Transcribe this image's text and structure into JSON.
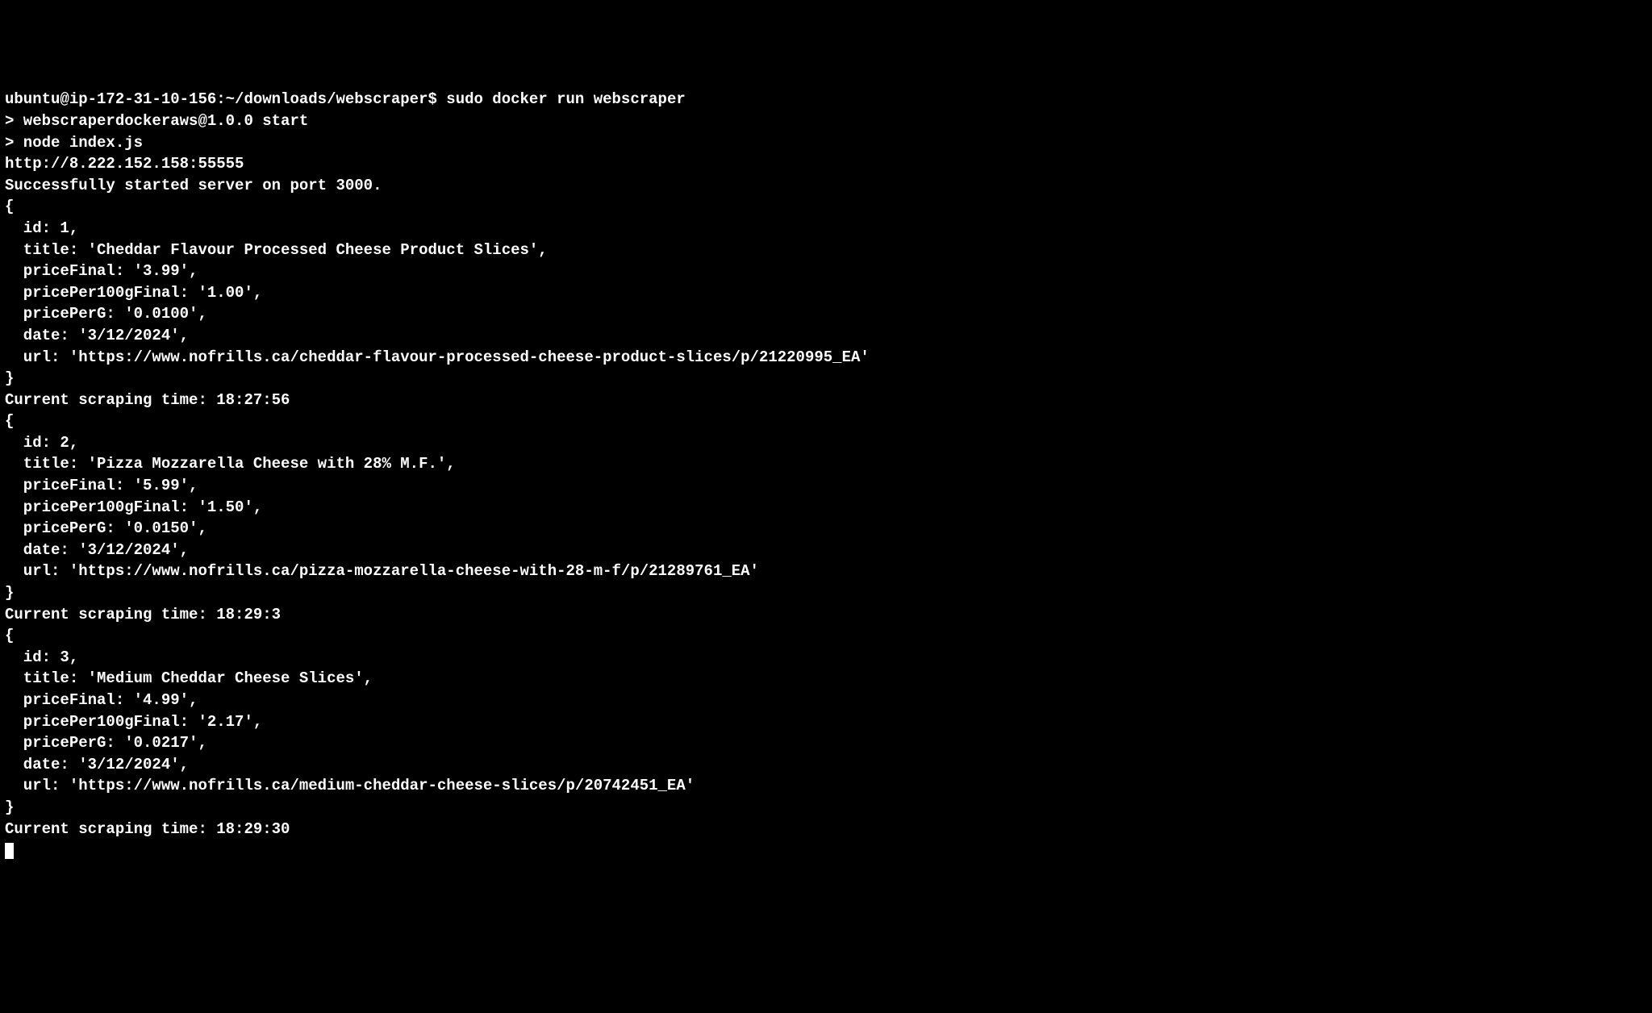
{
  "terminal": {
    "prompt": "ubuntu@ip-172-31-10-156:~/downloads/webscraper$ ",
    "command": "sudo docker run webscraper",
    "blank1": "",
    "line1": "> webscraperdockeraws@1.0.0 start",
    "line2": "> node index.js",
    "blank2": "",
    "line3": "http://8.222.152.158:55555",
    "line4": "Successfully started server on port 3000.",
    "obj1_open": "{",
    "obj1_id": "  id: 1,",
    "obj1_title": "  title: 'Cheddar Flavour Processed Cheese Product Slices',",
    "obj1_priceFinal": "  priceFinal: '3.99',",
    "obj1_pricePer100g": "  pricePer100gFinal: '1.00',",
    "obj1_pricePerG": "  pricePerG: '0.0100',",
    "obj1_date": "  date: '3/12/2024',",
    "obj1_url": "  url: 'https://www.nofrills.ca/cheddar-flavour-processed-cheese-product-slices/p/21220995_EA'",
    "obj1_close": "}",
    "time1": "Current scraping time: 18:27:56",
    "obj2_open": "{",
    "obj2_id": "  id: 2,",
    "obj2_title": "  title: 'Pizza Mozzarella Cheese with 28% M.F.',",
    "obj2_priceFinal": "  priceFinal: '5.99',",
    "obj2_pricePer100g": "  pricePer100gFinal: '1.50',",
    "obj2_pricePerG": "  pricePerG: '0.0150',",
    "obj2_date": "  date: '3/12/2024',",
    "obj2_url": "  url: 'https://www.nofrills.ca/pizza-mozzarella-cheese-with-28-m-f/p/21289761_EA'",
    "obj2_close": "}",
    "time2": "Current scraping time: 18:29:3",
    "obj3_open": "{",
    "obj3_id": "  id: 3,",
    "obj3_title": "  title: 'Medium Cheddar Cheese Slices',",
    "obj3_priceFinal": "  priceFinal: '4.99',",
    "obj3_pricePer100g": "  pricePer100gFinal: '2.17',",
    "obj3_pricePerG": "  pricePerG: '0.0217',",
    "obj3_date": "  date: '3/12/2024',",
    "obj3_url": "  url: 'https://www.nofrills.ca/medium-cheddar-cheese-slices/p/20742451_EA'",
    "obj3_close": "}",
    "time3": "Current scraping time: 18:29:30"
  }
}
